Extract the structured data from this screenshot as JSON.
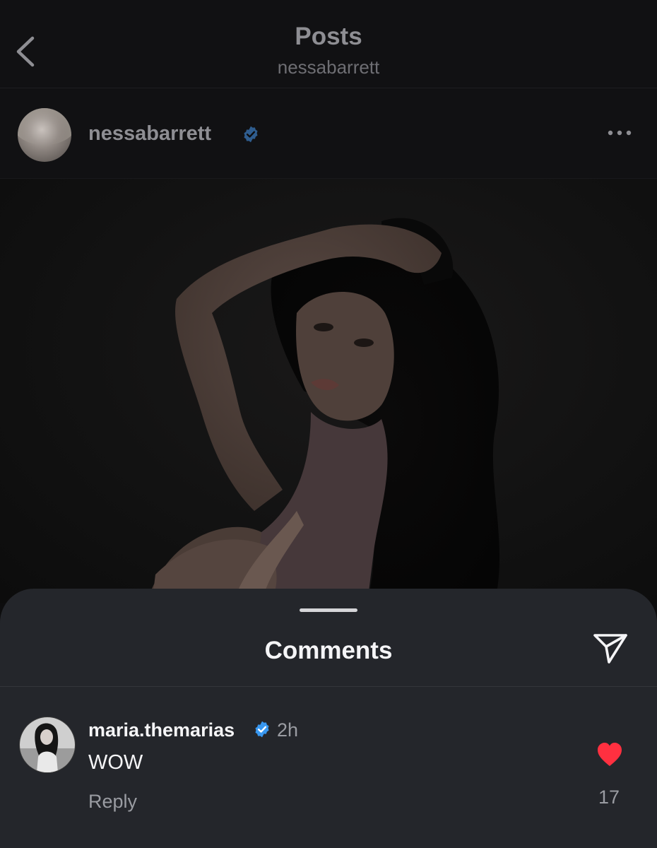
{
  "header": {
    "title": "Posts",
    "subtitle": "nessabarrett"
  },
  "post": {
    "author": "nessabarrett",
    "author_verified": true
  },
  "comments_sheet": {
    "title": "Comments",
    "comments": [
      {
        "username": "maria.themarias",
        "verified": true,
        "time": "2h",
        "text": "WOW",
        "reply_label": "Reply",
        "likes": "17",
        "liked": true
      }
    ]
  },
  "colors": {
    "verified_blue": "#3897f0",
    "like_red": "#ff3040",
    "sheet_bg": "#24262b"
  },
  "icons": [
    "back-chevron-icon",
    "verified-badge-icon",
    "more-options-icon",
    "share-send-icon",
    "heart-icon"
  ]
}
